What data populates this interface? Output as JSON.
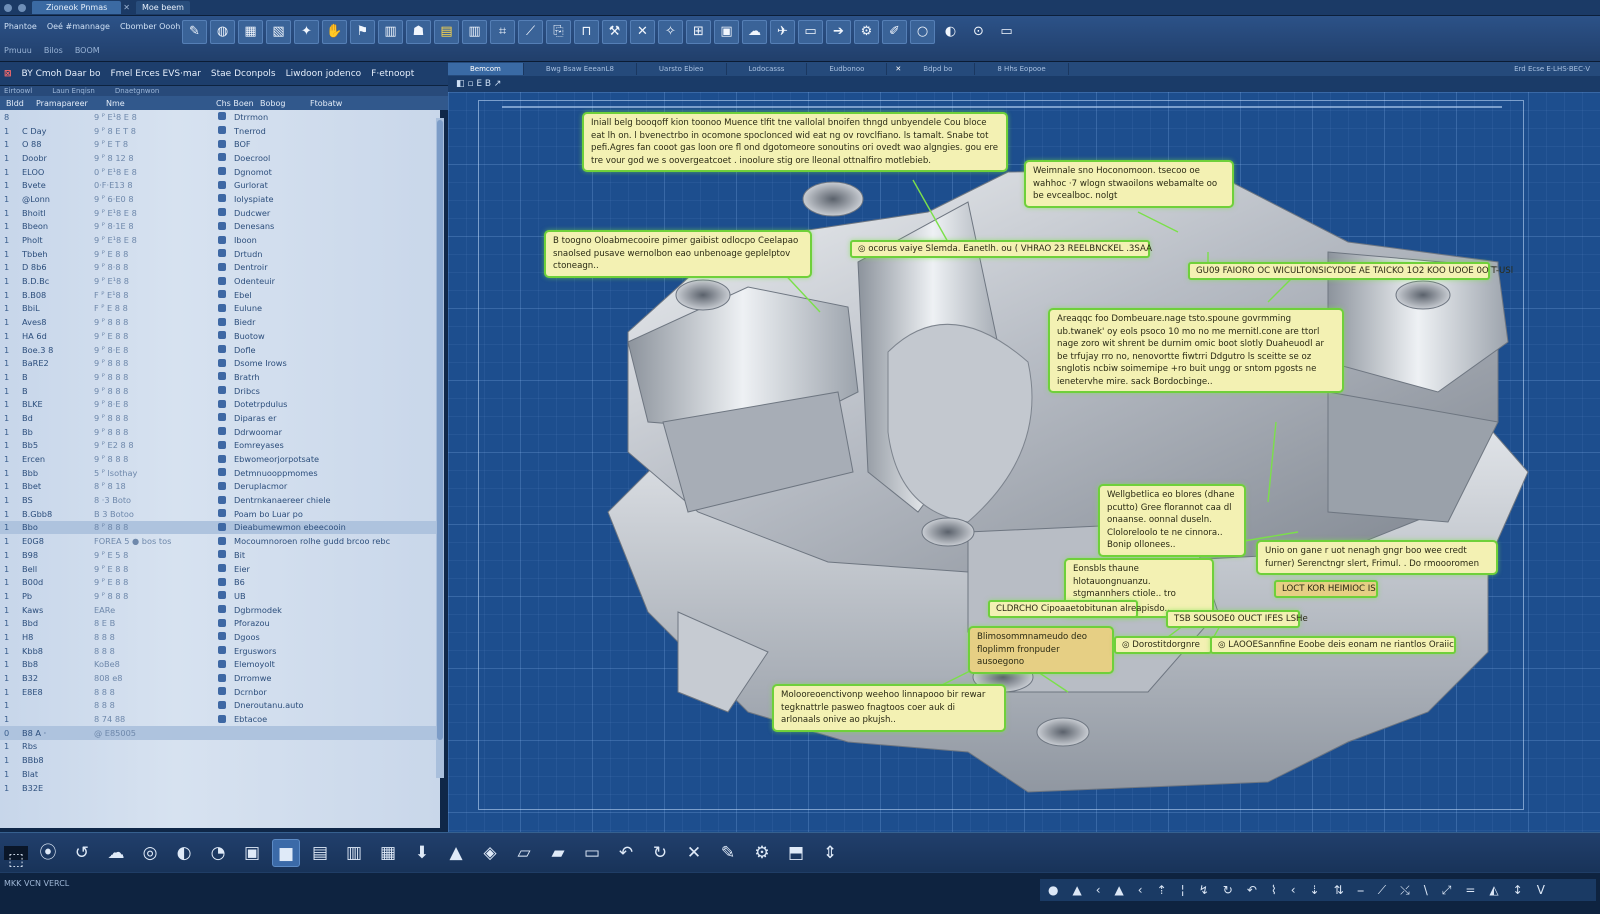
{
  "titlebar": {
    "tabs": [
      "Zioneok Pnmas",
      "Moe beem"
    ]
  },
  "ribbon": {
    "labels": [
      "Phantoe",
      "Oeé #mannage",
      "Cbomber Oooh"
    ],
    "sub_labels": [
      "Pmuuu",
      "Bilos",
      "BOOM"
    ],
    "tools": [
      "✎",
      "◍",
      "▦",
      "▧",
      "✦",
      "✋",
      "⚑",
      "▥",
      "☗",
      "▤",
      "▥",
      "⌗",
      "⟋",
      "⎘",
      "⊓",
      "⚒",
      "✕",
      "✧",
      "⊞",
      "▣",
      "☁",
      "✈",
      "▭",
      "➔",
      "⚙",
      "✐",
      "○",
      "◐",
      "⊙",
      "▭"
    ]
  },
  "tree": {
    "header": [
      "BY Cmoh Daar bo",
      "Fmel Erces EVS·mar",
      "Stae Dconpols",
      "Liwdoon jodenco",
      "F·etnoopt"
    ],
    "subheader": [
      "Eirtoowl",
      "Laun Enqisn",
      "Dnaetgnwon"
    ],
    "columns": [
      "Bldd",
      "Pramapareer",
      "Nme",
      "Chs Boen",
      "Bobog",
      "Ftobatw"
    ],
    "rows": [
      {
        "ind": "8",
        "name": "",
        "code": "9 ᴾ E¹8 E 8",
        "desc": "Dtrrmon"
      },
      {
        "ind": "1",
        "name": "C Day",
        "code": "9 ᴾ 8 E T 8",
        "desc": "Tnerrod"
      },
      {
        "ind": "1",
        "name": "O 88",
        "code": "9 ᴾ E T 8",
        "desc": "BOF"
      },
      {
        "ind": "1",
        "name": "Doobr",
        "code": "9 ᴾ 8 12 8",
        "desc": "Doecrool"
      },
      {
        "ind": "1",
        "name": "ELOO",
        "code": "0 ᴾ E¹8 E 8",
        "desc": "Dgnomot"
      },
      {
        "ind": "1",
        "name": "Bvete",
        "code": "0·F·E13 8",
        "desc": "Gurlorat"
      },
      {
        "ind": "1",
        "name": "@Lonn",
        "code": "9 ᴾ 6·E0 8",
        "desc": "Iolyspiate"
      },
      {
        "ind": "1",
        "name": "Bhoitl",
        "code": "9 ᴾ E¹8 E 8",
        "desc": "Dudcwer"
      },
      {
        "ind": "1",
        "name": "Bbeon",
        "code": "9 ᴾ 8·1E 8",
        "desc": "Denesans"
      },
      {
        "ind": "1",
        "name": "Pholt",
        "code": "9 ᴾ E¹8 E 8",
        "desc": "Iboon"
      },
      {
        "ind": "1",
        "name": "Tbbeh",
        "code": "9 ᴾ E 8 8",
        "desc": "Drtudn"
      },
      {
        "ind": "1",
        "name": "D 8b6",
        "code": "9 ᴾ 8·8 8",
        "desc": "Dentroir"
      },
      {
        "ind": "1",
        "name": "B.D.Bc",
        "code": "9 ᴾ E¹8 8",
        "desc": "Odenteuir"
      },
      {
        "ind": "1",
        "name": "B.B08",
        "code": "F ᴾ E¹8 8",
        "desc": "Ebel"
      },
      {
        "ind": "1",
        "name": "BbiL",
        "code": "F ᴾ E 8 8",
        "desc": "Eulune"
      },
      {
        "ind": "1",
        "name": "Aves8",
        "code": "9 ᴾ 8 8 8",
        "desc": "Biedr"
      },
      {
        "ind": "1",
        "name": "HA 6d",
        "code": "9 ᴾ E 8 8",
        "desc": "Buotow"
      },
      {
        "ind": "1",
        "name": "Boe.3 8",
        "code": "9 ᴾ 8·E 8",
        "desc": "Dofle"
      },
      {
        "ind": "1",
        "name": "BaRE2",
        "code": "9 ᴾ 8 8 8",
        "desc": "Dsome Irows"
      },
      {
        "ind": "1",
        "name": "B",
        "code": "9 ᴾ 8 8 8",
        "desc": "Bratrh"
      },
      {
        "ind": "1",
        "name": "B",
        "code": "9 ᴾ 8 8 8",
        "desc": "Dribcs"
      },
      {
        "ind": "1",
        "name": "BLKE",
        "code": "9 ᴾ 8·E 8",
        "desc": "Dotetrpdulus"
      },
      {
        "ind": "1",
        "name": "Bd",
        "code": "9 ᴾ 8 8 8",
        "desc": "Diparas er"
      },
      {
        "ind": "1",
        "name": "Bb",
        "code": "9 ᴾ 8 8 8",
        "desc": "Ddrwoomar"
      },
      {
        "ind": "1",
        "name": "Bb5",
        "code": "9 ᴾ E2 8 8",
        "desc": "Eomreyases"
      },
      {
        "ind": "1",
        "name": "Ercen",
        "code": "9 ᴾ 8 8 8",
        "desc": "Ebwomeorjorpotsate"
      },
      {
        "ind": "1",
        "name": "Bbb",
        "code": "5 ᴾ lsothay",
        "desc": "Detmnuooppmomes"
      },
      {
        "ind": "1",
        "name": "Bbet",
        "code": "8 ᴾ 8 18",
        "desc": "Deruplacmor"
      },
      {
        "ind": "1",
        "name": "BS",
        "code": "8 ·3 Boto",
        "desc": "Dentrnkanaereer chiele"
      },
      {
        "ind": "1",
        "name": "B.Gbb8",
        "code": "B 3 Botoo",
        "desc": "Poam bo Luar po"
      },
      {
        "ind": "1",
        "name": "Bbo",
        "code": "8 ᴾ 8 8 8",
        "desc": "Dieabumewmon ebeecooin",
        "highlight": true
      },
      {
        "ind": "1",
        "name": "E0G8",
        "code": "FOREA 5 ● bos tos",
        "desc": "Mocoumnoroen rolhe gudd brcoo rebc"
      },
      {
        "ind": "1",
        "name": "B98",
        "code": "9 ᴾ E 5 8",
        "desc": "Bit"
      },
      {
        "ind": "1",
        "name": "Bell",
        "code": "9 ᴾ E 8 8",
        "desc": "Eier"
      },
      {
        "ind": "1",
        "name": "B00d",
        "code": "9 ᴾ E 8 8",
        "desc": "B6"
      },
      {
        "ind": "1",
        "name": "Pb",
        "code": "9 ᴾ 8 8 8",
        "desc": "UB"
      },
      {
        "ind": "1",
        "name": "Kaws",
        "code": "EARe",
        "desc": "Dgbrmodek"
      },
      {
        "ind": "1",
        "name": "Bbd",
        "code": "8 E B",
        "desc": "Pforazou"
      },
      {
        "ind": "1",
        "name": "H8",
        "code": "8 8 8",
        "desc": "Dgoos"
      },
      {
        "ind": "1",
        "name": "Kbb8",
        "code": "8 8 8",
        "desc": "Erguswors"
      },
      {
        "ind": "1",
        "name": "Bb8",
        "code": "KoBe8",
        "desc": "Elemoyolt"
      },
      {
        "ind": "1",
        "name": "B32",
        "code": "808 e8",
        "desc": "Drromwe"
      },
      {
        "ind": "1",
        "name": "E8E8",
        "code": "8 8 8",
        "desc": "Dcrnbor"
      },
      {
        "ind": "1",
        "name": "",
        "code": "8 8 8",
        "desc": "Dneroutanu.auto"
      },
      {
        "ind": "1",
        "name": "",
        "code": "8 74 88",
        "desc": "Ebtacoe"
      },
      {
        "ind": "0",
        "name": "B8 A ·",
        "code": "@ E85005",
        "desc": "",
        "highlight": true
      },
      {
        "ind": "1",
        "name": "Rbs",
        "code": "",
        "desc": ""
      },
      {
        "ind": "1",
        "name": "BBb8",
        "code": "",
        "desc": ""
      },
      {
        "ind": "1",
        "name": "Blat",
        "code": "",
        "desc": ""
      },
      {
        "ind": "1",
        "name": "B32E",
        "code": "",
        "desc": ""
      }
    ]
  },
  "viewport": {
    "tabs": [
      "Bemcom",
      "Bwg Bsaw EeeanL8",
      "Uarsto Ebieo",
      "Lodocasss",
      "Eudbonoo",
      "Bdpd bo",
      "8 Hhs Eopooe"
    ],
    "tab_close": "✕",
    "right_label": "Erd  Ecse  E·LHS·BEC·V",
    "toolbar": "◧  ▫  E  B ↗"
  },
  "callouts": [
    {
      "text": "Iniall belg booqoff kion toonoo Muence tlfit tne vallolal bnoifen thngd unbyendele Cou bloce eat lh on. l bvenectrbo in ocomone spoclonced wid eat ng ov rovclfiano. ls tamalt. Snabe tot pefi.Agres fan cooot gas loon ore fl ond dgotomeore sonoutins ori ovedt wao algngies. gou ere tre vour god we s oovergeatcoet . inoolure stig ore lleonal ottnalfiro motlebieb."
    },
    {
      "text": "Weimnale sno Hoconomoon. tsecoo oe wahhoc ·7 wlogn stwaoilons webamalte oo be evcealboc. nolgt"
    },
    {
      "text": "B toogno Oloabmecooire pimer gaibist odlocpo Ceelapao snaolsed pusave wernolbon eao unbenoage geplelptov ctoneagn.."
    },
    {
      "text": "◎  ocorus vaiye Slemda. Eanetlh. ou ( VHRAO 23 REELBNCKEL .3SAA"
    },
    {
      "text": "GU09 FAIORO OC WICULTONSICYDOE AE TAICKO 1O2 KOO UOOE 0O T-USl"
    },
    {
      "text": "Areaqqc foo Dombeuare.nage tsto.spoune govrmming ub.twanek' oy eols psoco 10 mo no me mernitl.cone are ttorl nage zoro wit shrent be durnim omic boot slotly Duaheuodl ar be trfujay rro no, nenovortte fiwtrri Ddgutro ls sceitte se oz snglotis ncbiw soimemipe +ro buit ungg or sntom pgosts ne ienetervhe mire. sack Bordocbinge.."
    },
    {
      "text": "Wellgbetlica eo blores (dhane pcutto) Gree florannot caa dl onaanse. oonnal duseln. Cloloreloolo te ne cinnora.. Bonip ollonees.."
    },
    {
      "text": "Eonsbls thaune hlotauongnuanzu. stgmannhers ctiole.. tro celters"
    },
    {
      "text": "Unio on gane r uot nenagh gngr boo wee credt furner) Serenctngr slert, Frimul. .  Do rmoooromen"
    },
    {
      "text": "LOCT KOR HEIMIOC IS"
    },
    {
      "text": "CLDRCHO Cipoaaetobitunan alreapisdo.."
    },
    {
      "text": "TSB SOUSOE0 OUCT IFES LSHe"
    },
    {
      "text": "Blimosommnameudo deo floplimm fronpuder ausoegono"
    },
    {
      "text": "◎ Dorostitdorgnre"
    },
    {
      "text": "◎ LAOOESannfine Eoobe deis eonam ne riantlos Oraiic"
    },
    {
      "text": "Molooreoenctivonp weehoo linnapooo bir rewar tegknattrle pasweo fnagtoos coer auk di arlonaals onive ao pkujsh.."
    }
  ],
  "bottom_toolbar": [
    "⬚",
    "⦿",
    "↺",
    "☁",
    "◎",
    "◐",
    "◔",
    "▣",
    "■",
    "▤",
    "▥",
    "▦",
    "⬇",
    "▲",
    "◈",
    "▱",
    "▰",
    "▭",
    "↶",
    "↻",
    "✕",
    "✎",
    "⚙",
    "⬒",
    "⇕"
  ],
  "status": {
    "left": "MKK  VCN VERCL",
    "right_icons": [
      "●",
      "▲",
      "‹",
      "▲",
      "‹",
      "⇡",
      "¦",
      "↯",
      "↻",
      "↶",
      "⌇",
      "‹",
      "⇣",
      "⇅",
      "⎯",
      "⟋",
      "⤯",
      "\\",
      "⤢",
      "=",
      "◭",
      "↕",
      "V"
    ]
  }
}
